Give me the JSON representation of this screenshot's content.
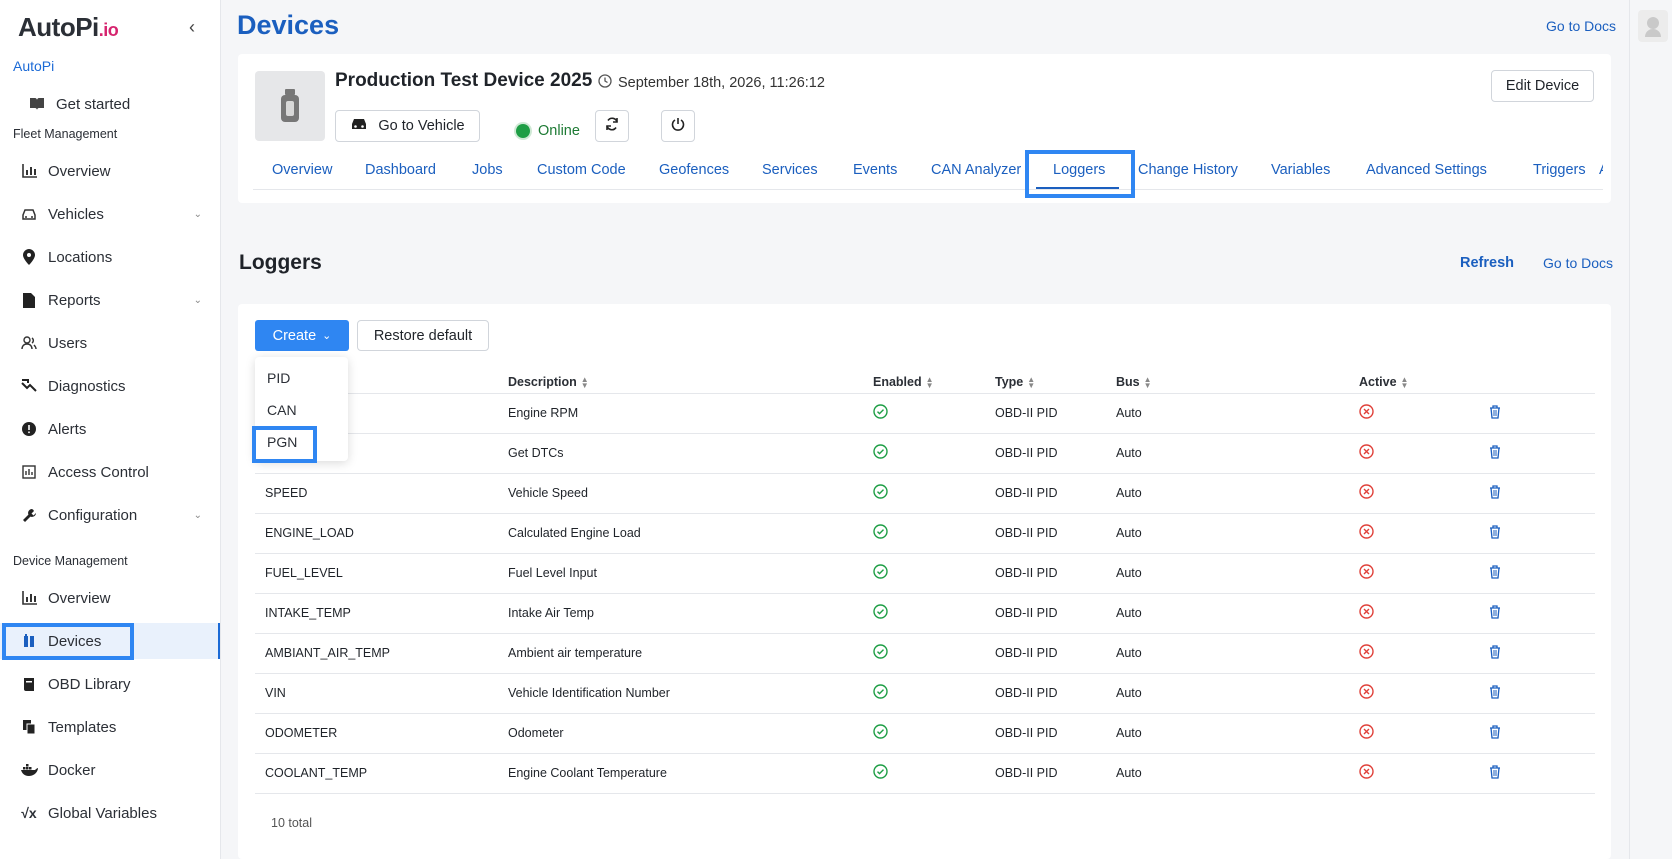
{
  "sidebar": {
    "logo": "AutoPi",
    "logo_suffix": ".io",
    "org": "AutoPi",
    "get_started": "Get started",
    "fleet_label": "Fleet Management",
    "fleet_items": [
      "Overview",
      "Vehicles",
      "Locations",
      "Reports",
      "Users",
      "Diagnostics",
      "Alerts",
      "Access Control",
      "Configuration"
    ],
    "device_label": "Device Management",
    "device_items": [
      "Overview",
      "Devices",
      "OBD Library",
      "Templates",
      "Docker",
      "Global Variables"
    ]
  },
  "header": {
    "title": "Devices",
    "docs_link": "Go to Docs"
  },
  "device": {
    "name": "Production Test Device 2025",
    "timestamp": "September 18th, 2026, 11:26:12",
    "go_to_vehicle": "Go to Vehicle",
    "status": "Online",
    "edit": "Edit Device",
    "tabs": [
      "Overview",
      "Dashboard",
      "Jobs",
      "Custom Code",
      "Geofences",
      "Services",
      "Events",
      "CAN Analyzer",
      "Loggers",
      "Change History",
      "Variables",
      "Advanced Settings",
      "Triggers",
      "A"
    ],
    "active_tab": "Loggers"
  },
  "loggers": {
    "title": "Loggers",
    "refresh": "Refresh",
    "docs": "Go to Docs",
    "create": "Create",
    "restore": "Restore default",
    "dropdown": [
      "PID",
      "CAN",
      "PGN"
    ],
    "columns": [
      "Description",
      "Enabled",
      "Type",
      "Bus",
      "Active"
    ],
    "rows": [
      {
        "name": "",
        "description": "Engine RPM",
        "type": "OBD-II PID",
        "bus": "Auto"
      },
      {
        "name": "",
        "description": "Get DTCs",
        "type": "OBD-II PID",
        "bus": "Auto"
      },
      {
        "name": "SPEED",
        "description": "Vehicle Speed",
        "type": "OBD-II PID",
        "bus": "Auto"
      },
      {
        "name": "ENGINE_LOAD",
        "description": "Calculated Engine Load",
        "type": "OBD-II PID",
        "bus": "Auto"
      },
      {
        "name": "FUEL_LEVEL",
        "description": "Fuel Level Input",
        "type": "OBD-II PID",
        "bus": "Auto"
      },
      {
        "name": "INTAKE_TEMP",
        "description": "Intake Air Temp",
        "type": "OBD-II PID",
        "bus": "Auto"
      },
      {
        "name": "AMBIANT_AIR_TEMP",
        "description": "Ambient air temperature",
        "type": "OBD-II PID",
        "bus": "Auto"
      },
      {
        "name": "VIN",
        "description": "Vehicle Identification Number",
        "type": "OBD-II PID",
        "bus": "Auto"
      },
      {
        "name": "ODOMETER",
        "description": "Odometer",
        "type": "OBD-II PID",
        "bus": "Auto"
      },
      {
        "name": "COOLANT_TEMP",
        "description": "Engine Coolant Temperature",
        "type": "OBD-II PID",
        "bus": "Auto"
      }
    ],
    "total": "10 total"
  },
  "colors": {
    "primary": "#2f86f2",
    "link": "#1b5fbf",
    "success": "#1e9e45",
    "danger": "#e0413a"
  }
}
